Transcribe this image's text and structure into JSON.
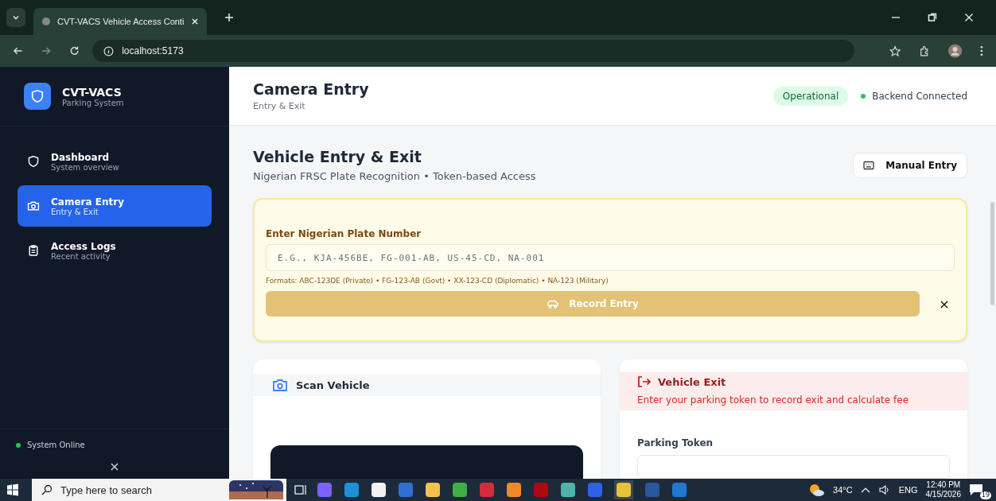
{
  "browser": {
    "tab_title": "CVT-VACS Vehicle Access Conti",
    "url": "localhost:5173"
  },
  "sidebar": {
    "app_name": "CVT-VACS",
    "app_subtitle": "Parking System",
    "items": [
      {
        "label": "Dashboard",
        "sublabel": "System overview",
        "kind": "shield",
        "selected": false
      },
      {
        "label": "Camera Entry",
        "sublabel": "Entry & Exit",
        "kind": "camera",
        "selected": true
      },
      {
        "label": "Access Logs",
        "sublabel": "Recent activity",
        "kind": "clipboard",
        "selected": false
      }
    ],
    "status": "System Online",
    "close": "×"
  },
  "header": {
    "title": "Camera Entry",
    "subtitle": "Entry & Exit",
    "status_badge": "Operational",
    "connection": "Backend Connected"
  },
  "page": {
    "title": "Vehicle Entry & Exit",
    "subtitle": "Nigerian FRSC Plate Recognition • Token-based Access",
    "manual_button": "Manual Entry"
  },
  "entry_form": {
    "label": "Enter Nigerian Plate Number",
    "placeholder": "E.G., KJA-456BE, FG-001-AB, US-45-CD, NA-001",
    "formats": "Formats: ABC-123DE (Private) • FG-123-AB (Govt) • XX-123-CD (Diplomatic) • NA-123 (Military)",
    "submit": "Record Entry",
    "submit_disabled": true,
    "close": "×"
  },
  "scan_card": {
    "title": "Scan Vehicle"
  },
  "exit_card": {
    "title": "Vehicle Exit",
    "description": "Enter your parking token to record exit and calculate fee",
    "token_label": "Parking Token"
  },
  "taskbar": {
    "search_placeholder": "Type here to search",
    "temperature": "34°C",
    "language": "ENG",
    "time": "12:40 PM",
    "date": "4/15/2026",
    "notifications": "19"
  }
}
